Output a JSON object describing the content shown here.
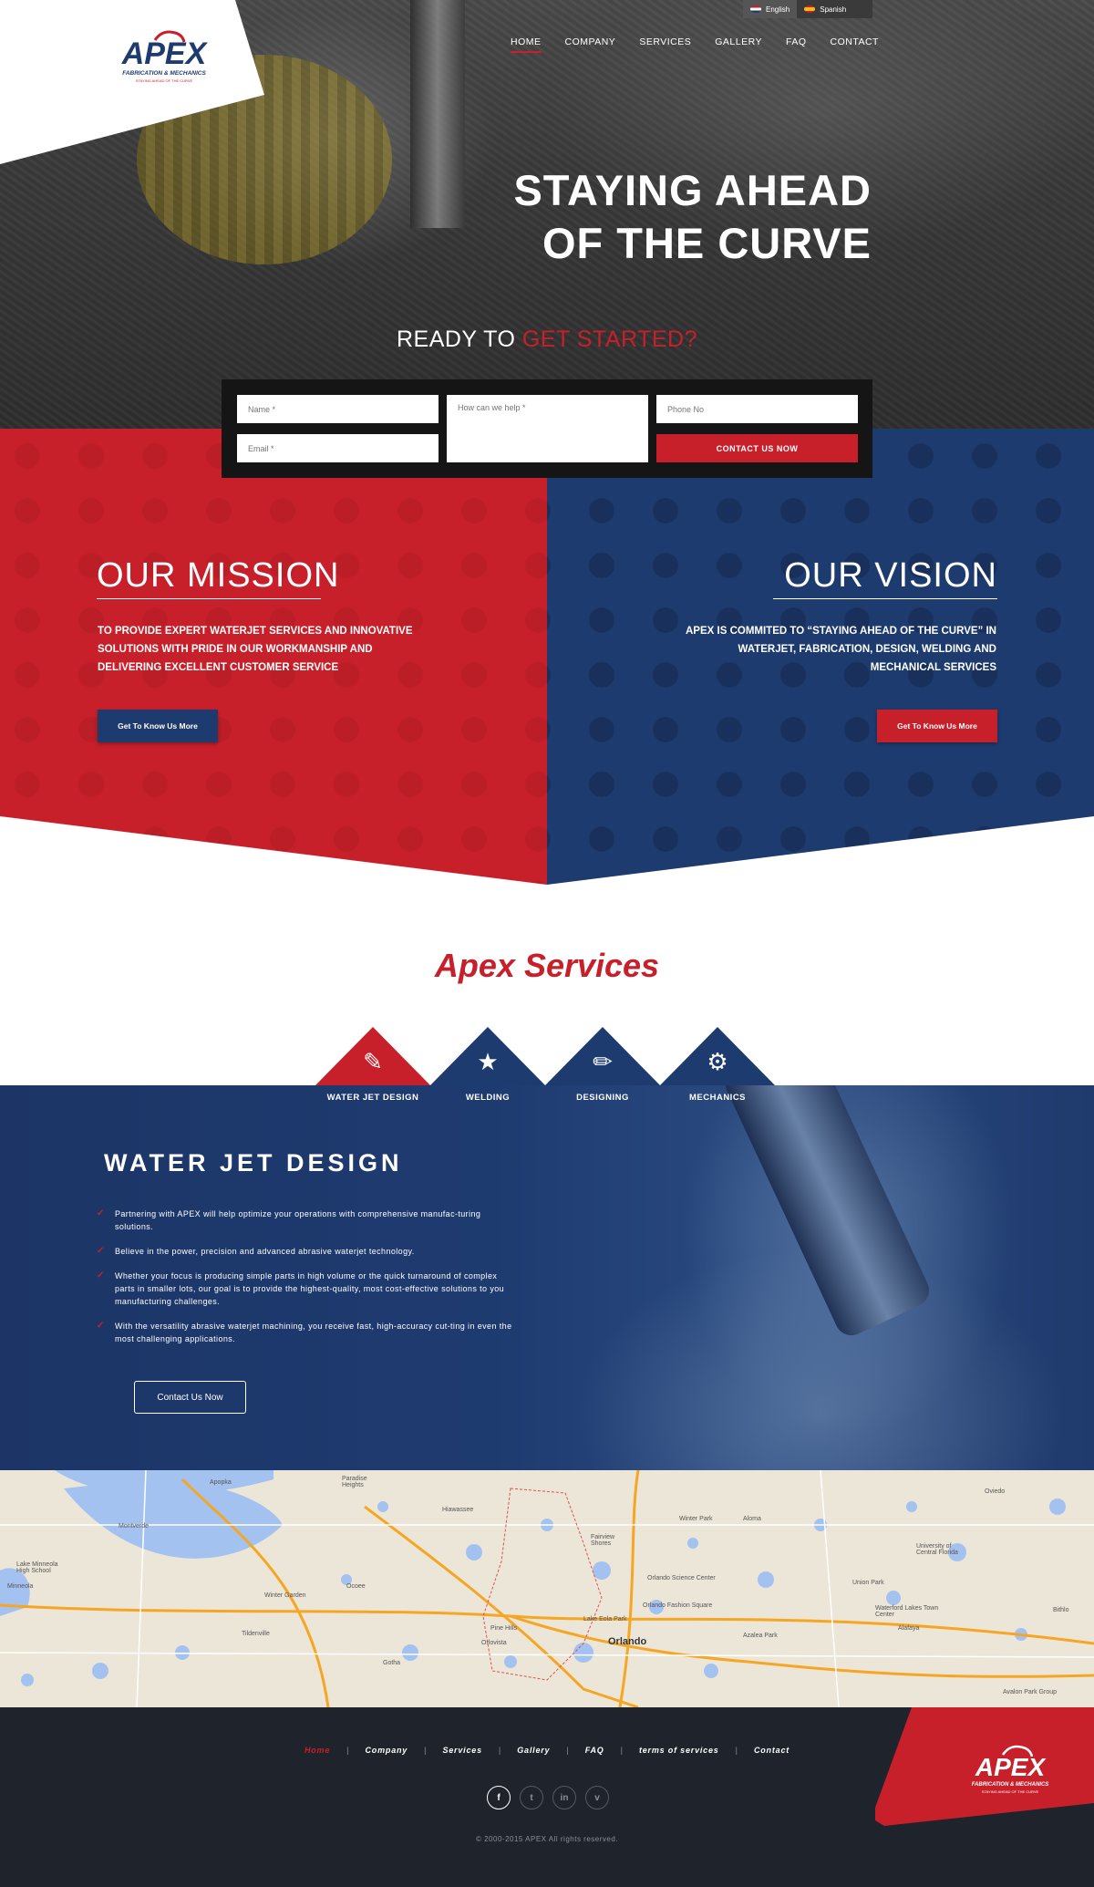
{
  "brand": {
    "name": "APEX",
    "subtitle": "FABRICATION & MECHANICS",
    "tagline": "STAYING AHEAD OF THE CURVE"
  },
  "colors": {
    "red": "#c8202a",
    "blue": "#1e3b70",
    "dark": "#1f232b"
  },
  "languages": [
    {
      "label": "English",
      "flag": "#e5e5e5"
    },
    {
      "label": "Spanish",
      "flag": "#f1b820"
    }
  ],
  "nav": [
    {
      "label": "HOME",
      "active": true
    },
    {
      "label": "COMPANY"
    },
    {
      "label": "SERVICES"
    },
    {
      "label": "GALLERY"
    },
    {
      "label": "FAQ"
    },
    {
      "label": "CONTACT"
    }
  ],
  "hero": {
    "title_line1": "STAYING AHEAD",
    "title_line2": "OF THE CURVE",
    "cta_prefix": "READY TO ",
    "cta_highlight": "GET STARTED?"
  },
  "contact_form": {
    "name_placeholder": "Name *",
    "email_placeholder": "Email *",
    "message_placeholder": "How can we help *",
    "phone_placeholder": "Phone No",
    "submit_label": "CONTACT US NOW"
  },
  "mission": {
    "title": "OUR MISSION",
    "text": "TO PROVIDE EXPERT WATERJET SERVICES AND INNOVATIVE SOLUTIONS WITH PRIDE IN OUR WORKMANSHIP AND DELIVERING EXCELLENT CUSTOMER SERVICE",
    "button": "Get To Know Us More"
  },
  "vision": {
    "title": "OUR VISION",
    "text": "APEX IS COMMITED TO “STAYING AHEAD OF THE CURVE” IN WATERJET, FABRICATION, DESIGN, WELDING AND MECHANICAL SERVICES",
    "button": "Get To Know Us More"
  },
  "services": {
    "title": "Apex Services",
    "tabs": [
      {
        "label": "WATER JET DESIGN",
        "icon": "waterjet-icon",
        "active": true
      },
      {
        "label": "WELDING",
        "icon": "welder-icon"
      },
      {
        "label": "DESIGNING",
        "icon": "pencil-icon"
      },
      {
        "label": "MECHANICS",
        "icon": "wrench-hand-icon"
      }
    ],
    "panel": {
      "heading": "WATER JET DESIGN",
      "items": [
        "Partnering with APEX will help optimize your operations with comprehensive manufac-turing solutions.",
        "Believe in the power, precision and advanced abrasive waterjet technology.",
        "Whether your focus is producing simple parts in high volume or the quick turnaround of complex parts in smaller lots, our goal is to provide the highest-quality, most cost-effective solutions to you manufacturing challenges.",
        "With the versatility abrasive waterjet machining, you receive fast, high-accuracy cut-ting in even the most challenging applications."
      ],
      "button": "Contact Us Now"
    }
  },
  "map": {
    "labels": [
      "Apopka",
      "Paradise Heights",
      "Montverde",
      "Lake Minneola High School",
      "Minneola",
      "Ocoee",
      "Winter Garden",
      "Tildenville",
      "Hiawassee",
      "Pine Hills",
      "Orlovista",
      "Gotha",
      "Fairview Shores",
      "Winter Park",
      "Aloma",
      "Orlando Science Center",
      "Orlando Fashion Square",
      "Orlando",
      "Azalea Park",
      "University of Central Florida",
      "Union Park",
      "Waterford Lakes Town Center",
      "Alafaya",
      "Bithlo",
      "Avalon Park Group",
      "Lake Eola Park",
      "Oviedo"
    ]
  },
  "footer": {
    "nav": [
      {
        "label": "Home",
        "active": true
      },
      {
        "label": "Company"
      },
      {
        "label": "Services"
      },
      {
        "label": "Gallery"
      },
      {
        "label": "FAQ"
      },
      {
        "label": "terms of services"
      },
      {
        "label": "Contact"
      }
    ],
    "separator": "|",
    "social": [
      {
        "glyph": "f",
        "icon": "facebook-icon"
      },
      {
        "glyph": "t",
        "icon": "twitter-icon"
      },
      {
        "glyph": "in",
        "icon": "linkedin-icon"
      },
      {
        "glyph": "v",
        "icon": "vimeo-icon"
      }
    ],
    "copyright": "© 2000-2015 APEX All rights reserved."
  }
}
